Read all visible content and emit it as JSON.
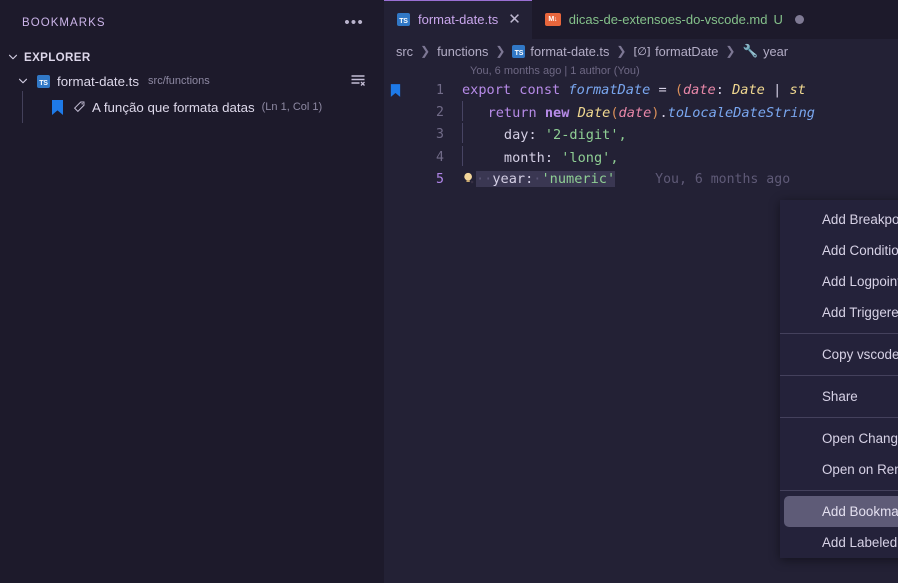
{
  "sidebar": {
    "title": "BOOKMARKS",
    "more_icon": "ellipsis-icon",
    "section": {
      "label": "EXPLORER",
      "expanded": true
    },
    "file": {
      "name": "format-date.ts",
      "path": "src/functions",
      "badge": "TS",
      "clear_icon": "clear-all-icon"
    },
    "bookmark": {
      "label": "A função que formata datas",
      "position": "(Ln 1, Col 1)",
      "icon": "bookmark-icon",
      "tag_icon": "tag-icon"
    }
  },
  "tabs": [
    {
      "label": "format-date.ts",
      "badge": "TS",
      "active": true,
      "close_icon": "close-icon"
    },
    {
      "label": "dicas-de-extensoes-do-vscode.md",
      "badge": "M↓",
      "active": false,
      "git_status": "U",
      "dirty": true
    }
  ],
  "breadcrumb": [
    {
      "label": "src",
      "icon": ""
    },
    {
      "label": "functions",
      "icon": ""
    },
    {
      "label": "format-date.ts",
      "icon": "ts-file-icon"
    },
    {
      "label": "formatDate",
      "icon": "symbol-variable-icon"
    },
    {
      "label": "year",
      "icon": "symbol-property-icon"
    }
  ],
  "editor": {
    "blame_top": "You, 6 months ago | 1 author (You)",
    "blame_inline": "You, 6 months ago",
    "lines": [
      {
        "no": "1",
        "bookmarked": true
      },
      {
        "no": "2",
        "bookmarked": false
      },
      {
        "no": "3",
        "bookmarked": false
      },
      {
        "no": "4",
        "bookmarked": false
      },
      {
        "no": "5",
        "bookmarked": false,
        "active": true,
        "lightbulb": true
      }
    ],
    "code": {
      "l1_export": "export",
      "l1_const": "const",
      "l1_name": "formatDate",
      "l1_eq": "=",
      "l1_paren": "(",
      "l1_param": "date",
      "l1_colon": ":",
      "l1_type": "Date",
      "l1_pipe": "|",
      "l1_tail": "st",
      "l2_return": "return",
      "l2_new": "new",
      "l2_date": "Date",
      "l2_open": "(",
      "l2_arg": "date",
      "l2_close": ")",
      "l2_dot": ".",
      "l2_method": "toLocaleDateString",
      "l3_key": "day:",
      "l3_val": "'2-digit',",
      "l4_key": "month:",
      "l4_val": "'long',",
      "l5_key": "year:",
      "l5_val": "'numeric'"
    }
  },
  "context_menu": {
    "items": [
      {
        "label": "Add Breakpoint",
        "submenu": false,
        "highlight": false
      },
      {
        "label": "Add Conditional Breakpoint...",
        "submenu": false,
        "highlight": false
      },
      {
        "label": "Add Logpoint...",
        "submenu": false,
        "highlight": false
      },
      {
        "label": "Add Triggered Breakpoint...",
        "submenu": false,
        "highlight": false
      },
      {
        "separator": true
      },
      {
        "label": "Copy vscode.dev Link",
        "submenu": false,
        "highlight": false
      },
      {
        "separator": true
      },
      {
        "label": "Share",
        "submenu": true,
        "submenu_color": "#a472d4",
        "highlight": false
      },
      {
        "separator": true
      },
      {
        "label": "Open Changes",
        "submenu": true,
        "highlight": false
      },
      {
        "label": "Open on Remote (Web)",
        "submenu": true,
        "highlight": false
      },
      {
        "separator": true
      },
      {
        "label": "Add Bookmark",
        "submenu": false,
        "highlight": true
      },
      {
        "label": "Add Labeled Bookmark",
        "submenu": false,
        "highlight": false
      }
    ],
    "chevron_glyph": "❯"
  },
  "colors": {
    "sidebar_bg": "#1d1a2b",
    "editor_bg": "#232135",
    "menu_bg": "#24223a",
    "menu_highlight": "#5e5b77",
    "accent_purple": "#9a6fd4",
    "bookmark_blue": "#1e7ae8",
    "git_green": "#84c08a",
    "ts_blue": "#3178c6",
    "md_orange": "#e8663c"
  }
}
